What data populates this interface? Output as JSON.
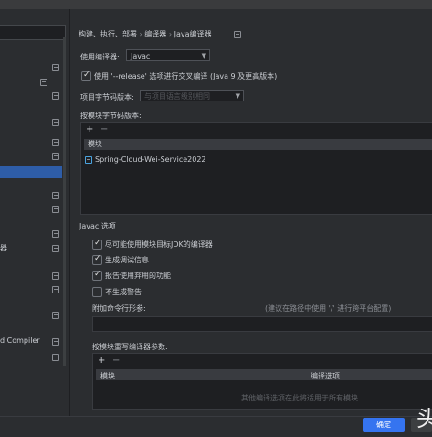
{
  "breadcrumb": {
    "items": [
      "构建、执行、部署",
      "编译器",
      "Java编译器"
    ],
    "separator": "›"
  },
  "sidebar": {
    "items": [
      {
        "label": "器"
      },
      {
        "label": "d Compiler"
      }
    ]
  },
  "compiler": {
    "label": "使用编译器:",
    "value": "Javac"
  },
  "release_option": {
    "label": "使用 '--release' 选项进行交叉编译 (Java 9 及更高版本)",
    "checked": true
  },
  "project_bytecode": {
    "label": "项目字节码版本:",
    "placeholder": "与项目语言级别相同"
  },
  "per_module_bytecode": {
    "label": "按模块字节码版本:",
    "add": "+",
    "remove": "−",
    "column_header": "模块",
    "rows": [
      "Spring-Cloud-Wei-Service2022"
    ]
  },
  "javac": {
    "section_title": "Javac 选项",
    "options": [
      {
        "label": "尽可能使用模块目标JDK的编译器",
        "checked": true
      },
      {
        "label": "生成调试信息",
        "checked": true
      },
      {
        "label": "报告使用弃用的功能",
        "checked": true
      },
      {
        "label": "不生成警告",
        "checked": false
      }
    ],
    "additional_params_label": "附加命令行形参:",
    "additional_params_hint": "(建议在路径中使用 '/' 进行跨平台配置)"
  },
  "override_params": {
    "label": "按模块重写编译器参数:",
    "add": "+",
    "remove": "−",
    "columns": [
      "模块",
      "编译选项"
    ],
    "empty_text": "其他编译选项在此将适用于所有模块"
  },
  "footer": {
    "ok_label": "确定"
  },
  "overlay": {
    "glyph": "头"
  },
  "colors": {
    "accent": "#3574f0",
    "selection": "#2e5da8",
    "background": "#2b2d30"
  }
}
